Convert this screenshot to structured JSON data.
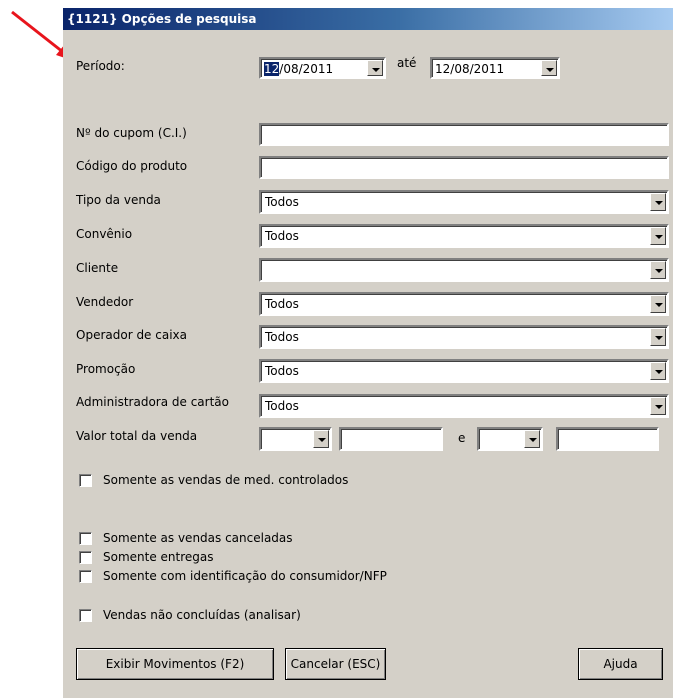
{
  "window": {
    "title": "{1121} Opções de pesquisa"
  },
  "periodo": {
    "label": "Período:",
    "from_selected": "12",
    "from_rest": "/08/2011",
    "ate_label": "até",
    "to_value": "12/08/2011"
  },
  "fields": {
    "cupom_label": "Nº do cupom (C.I.)",
    "codigo_label": "Código do produto",
    "tipo_label": "Tipo da venda",
    "tipo_value": "Todos",
    "convenio_label": "Convênio",
    "convenio_value": "Todos",
    "cliente_label": "Cliente",
    "cliente_value": "",
    "vendedor_label": "Vendedor",
    "vendedor_value": "Todos",
    "operador_label": "Operador de caixa",
    "operador_value": "Todos",
    "promocao_label": "Promoção",
    "promocao_value": "Todos",
    "admin_label": "Administradora de cartão",
    "admin_value": "Todos",
    "valor_label": "Valor total da venda",
    "valor_e": "e"
  },
  "checkboxes": {
    "controlados": "Somente as vendas de med. controlados",
    "canceladas": "Somente as vendas canceladas",
    "entregas": "Somente entregas",
    "identificacao": "Somente com identificação do consumidor/NFP",
    "nao_concluidas": "Vendas não concluídas (analisar)"
  },
  "buttons": {
    "exibir": "Exibir Movimentos (F2)",
    "cancelar": "Cancelar (ESC)",
    "ajuda": "Ajuda"
  },
  "colors": {
    "title_start": "#0a246a",
    "title_end": "#a6caf0",
    "dialog_bg": "#d4d0c8",
    "arrow": "#e8141c"
  }
}
